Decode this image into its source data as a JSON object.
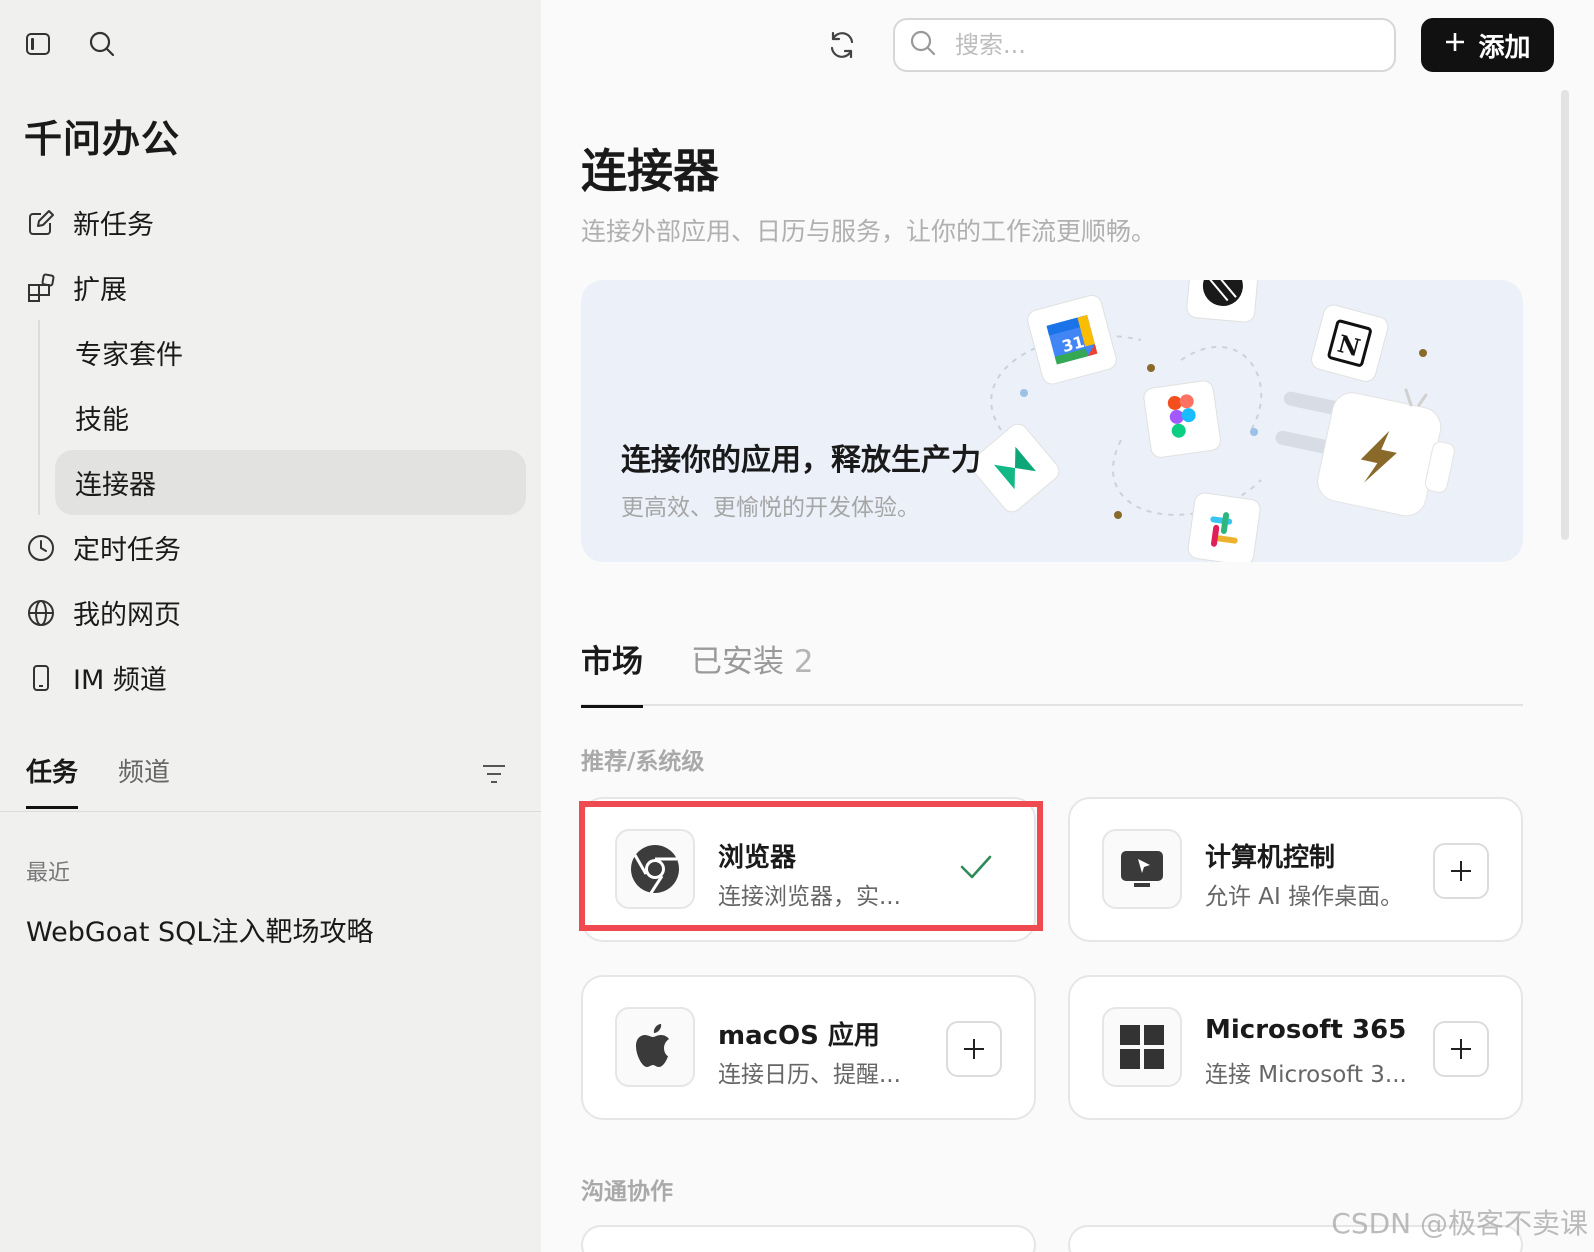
{
  "sidebar": {
    "app_title": "千问办公",
    "nav": [
      {
        "label": "新任务",
        "icon": "edit-icon"
      },
      {
        "label": "扩展",
        "icon": "extensions-icon"
      }
    ],
    "sub_items": [
      {
        "label": "专家套件"
      },
      {
        "label": "技能"
      },
      {
        "label": "连接器",
        "active": true
      }
    ],
    "nav2": [
      {
        "label": "定时任务",
        "icon": "clock-icon"
      },
      {
        "label": "我的网页",
        "icon": "globe-icon"
      },
      {
        "label": "IM 频道",
        "icon": "phone-icon"
      }
    ],
    "tabs": [
      {
        "label": "任务",
        "active": true
      },
      {
        "label": "频道",
        "active": false
      }
    ],
    "recent_label": "最近",
    "recent_items": [
      "WebGoat SQL注入靶场攻略"
    ]
  },
  "header": {
    "search_placeholder": "搜索...",
    "add_label": "添加"
  },
  "main": {
    "title": "连接器",
    "subtitle": "连接外部应用、日历与服务，让你的工作流更顺畅。",
    "banner": {
      "title": "连接你的应用，释放生产力",
      "subtitle": "更高效、更愉悦的开发体验。"
    },
    "tabs": [
      {
        "label": "市场",
        "active": true
      },
      {
        "label": "已安装",
        "count": "2",
        "active": false
      }
    ],
    "section1_label": "推荐/系统级",
    "section2_label": "沟通协作",
    "cards": [
      {
        "name": "浏览器",
        "desc": "连接浏览器，实...",
        "logo": "chrome-icon",
        "installed": true
      },
      {
        "name": "计算机控制",
        "desc": "允许 AI 操作桌面。",
        "logo": "computer-control-icon",
        "installed": false
      },
      {
        "name": "macOS 应用",
        "desc": "连接日历、提醒...",
        "logo": "apple-icon",
        "installed": false
      },
      {
        "name": "Microsoft 365",
        "desc": "连接 Microsoft 3...",
        "logo": "windows-icon",
        "installed": false
      }
    ]
  },
  "watermark": "CSDN @极客不卖课",
  "colors": {
    "accent": "#111111",
    "highlight": "#ef4a4f",
    "check": "#2e8b57",
    "banner_bg": "#ecf1f9"
  }
}
